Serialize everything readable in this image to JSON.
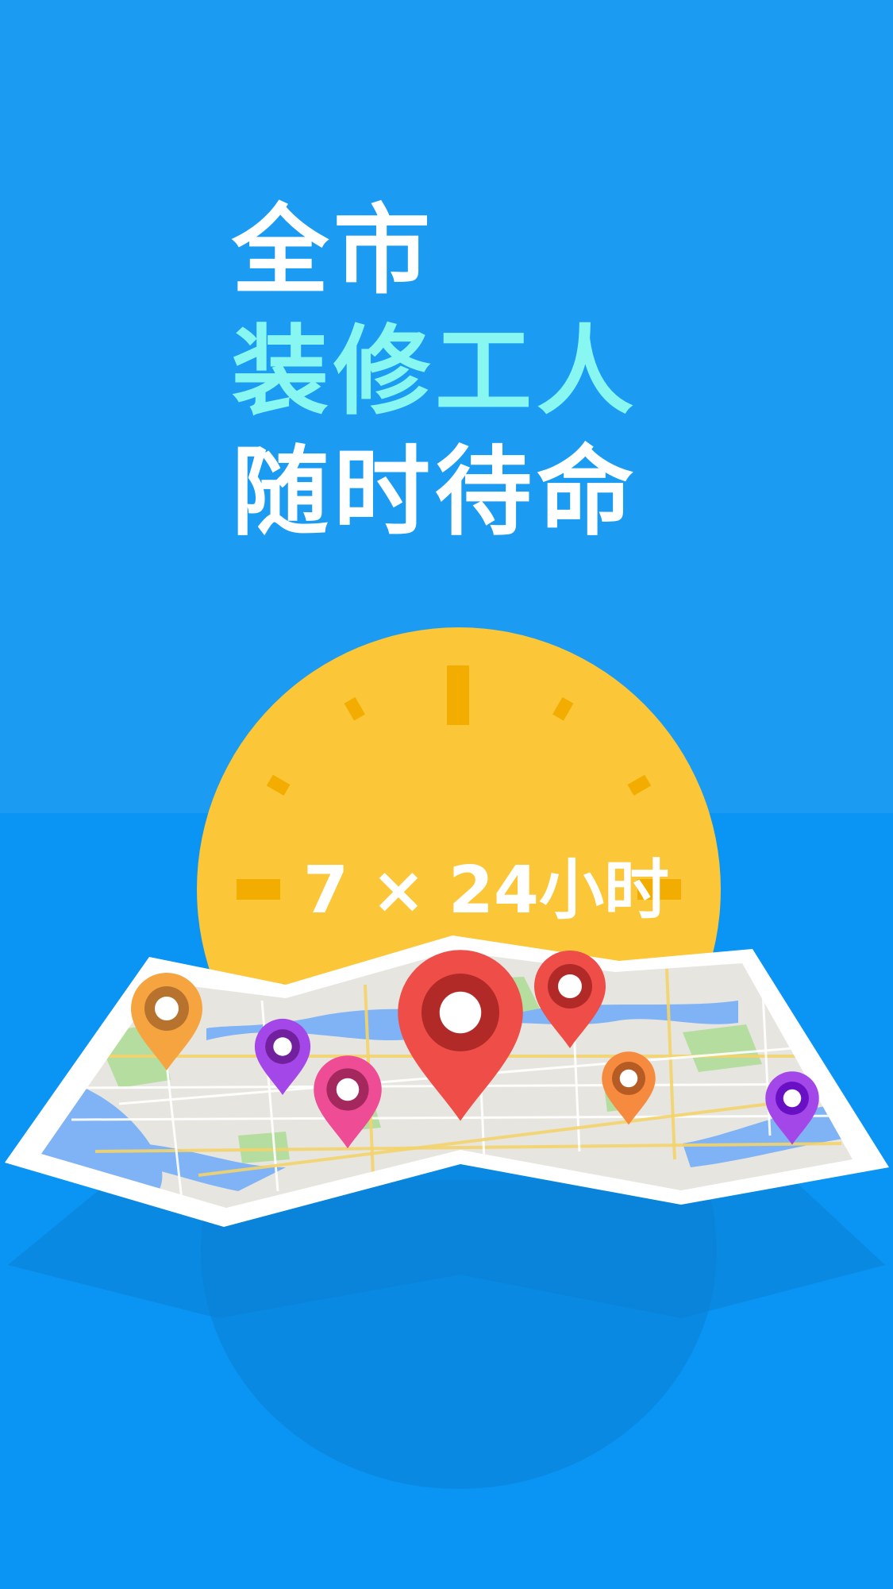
{
  "colors": {
    "background_top": "#1b9cf2",
    "background_bottom": "#0a94f3",
    "shadow": "#0a7fd4",
    "clock_face": "#fbc637",
    "clock_ticks": "#f2ad00",
    "headline_white": "#ffffff",
    "headline_accent": "#88f7f2",
    "map_border": "#ffffff",
    "map_land": "#e7e5df",
    "map_water": "#7fb3f5",
    "map_park": "#b5dda0"
  },
  "headline": {
    "line1": "全市",
    "line2": "装修工人",
    "line3": "随时待命"
  },
  "clock": {
    "label": "7 × 24小时"
  },
  "map": {
    "pins": [
      {
        "id": "orange-left",
        "color": "#f6a43f",
        "inner": "#b7732d"
      },
      {
        "id": "purple-left",
        "color": "#a347e8",
        "inner": "#72209e"
      },
      {
        "id": "pink",
        "color": "#ee4c94",
        "inner": "#a4285e"
      },
      {
        "id": "red-main",
        "color": "#ee4d48",
        "inner": "#b12a28"
      },
      {
        "id": "red-small",
        "color": "#ee4d48",
        "inner": "#b12a28"
      },
      {
        "id": "orange-right",
        "color": "#f68a3f",
        "inner": "#b55b23"
      },
      {
        "id": "purple-right",
        "color": "#a347e8",
        "inner": "#6a10c4"
      }
    ]
  }
}
